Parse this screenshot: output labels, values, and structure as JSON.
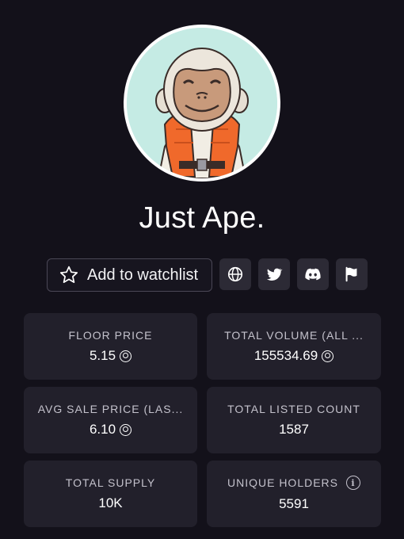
{
  "collection": {
    "name": "Just Ape."
  },
  "actions": {
    "watchlist_label": "Add to watchlist",
    "icons": [
      "globe-icon",
      "twitter-icon",
      "discord-icon",
      "flag-icon"
    ]
  },
  "stats": [
    {
      "label": "FLOOR PRICE",
      "value": "5.15",
      "currency": "sol-icon"
    },
    {
      "label": "TOTAL VOLUME (ALL ...",
      "value": "155534.69",
      "currency": "sol-icon"
    },
    {
      "label": "AVG SALE PRICE (LAS...",
      "value": "6.10",
      "currency": "sol-icon"
    },
    {
      "label": "TOTAL LISTED COUNT",
      "value": "1587"
    },
    {
      "label": "TOTAL SUPPLY",
      "value": "10K"
    },
    {
      "label": "UNIQUE HOLDERS",
      "value": "5591",
      "info": "info-icon"
    }
  ],
  "colors": {
    "background": "#13111a",
    "card": "#22202b",
    "icon_button": "#2c2a35",
    "avatar_bg": "#c5ebe4",
    "vest": "#f0692b"
  }
}
